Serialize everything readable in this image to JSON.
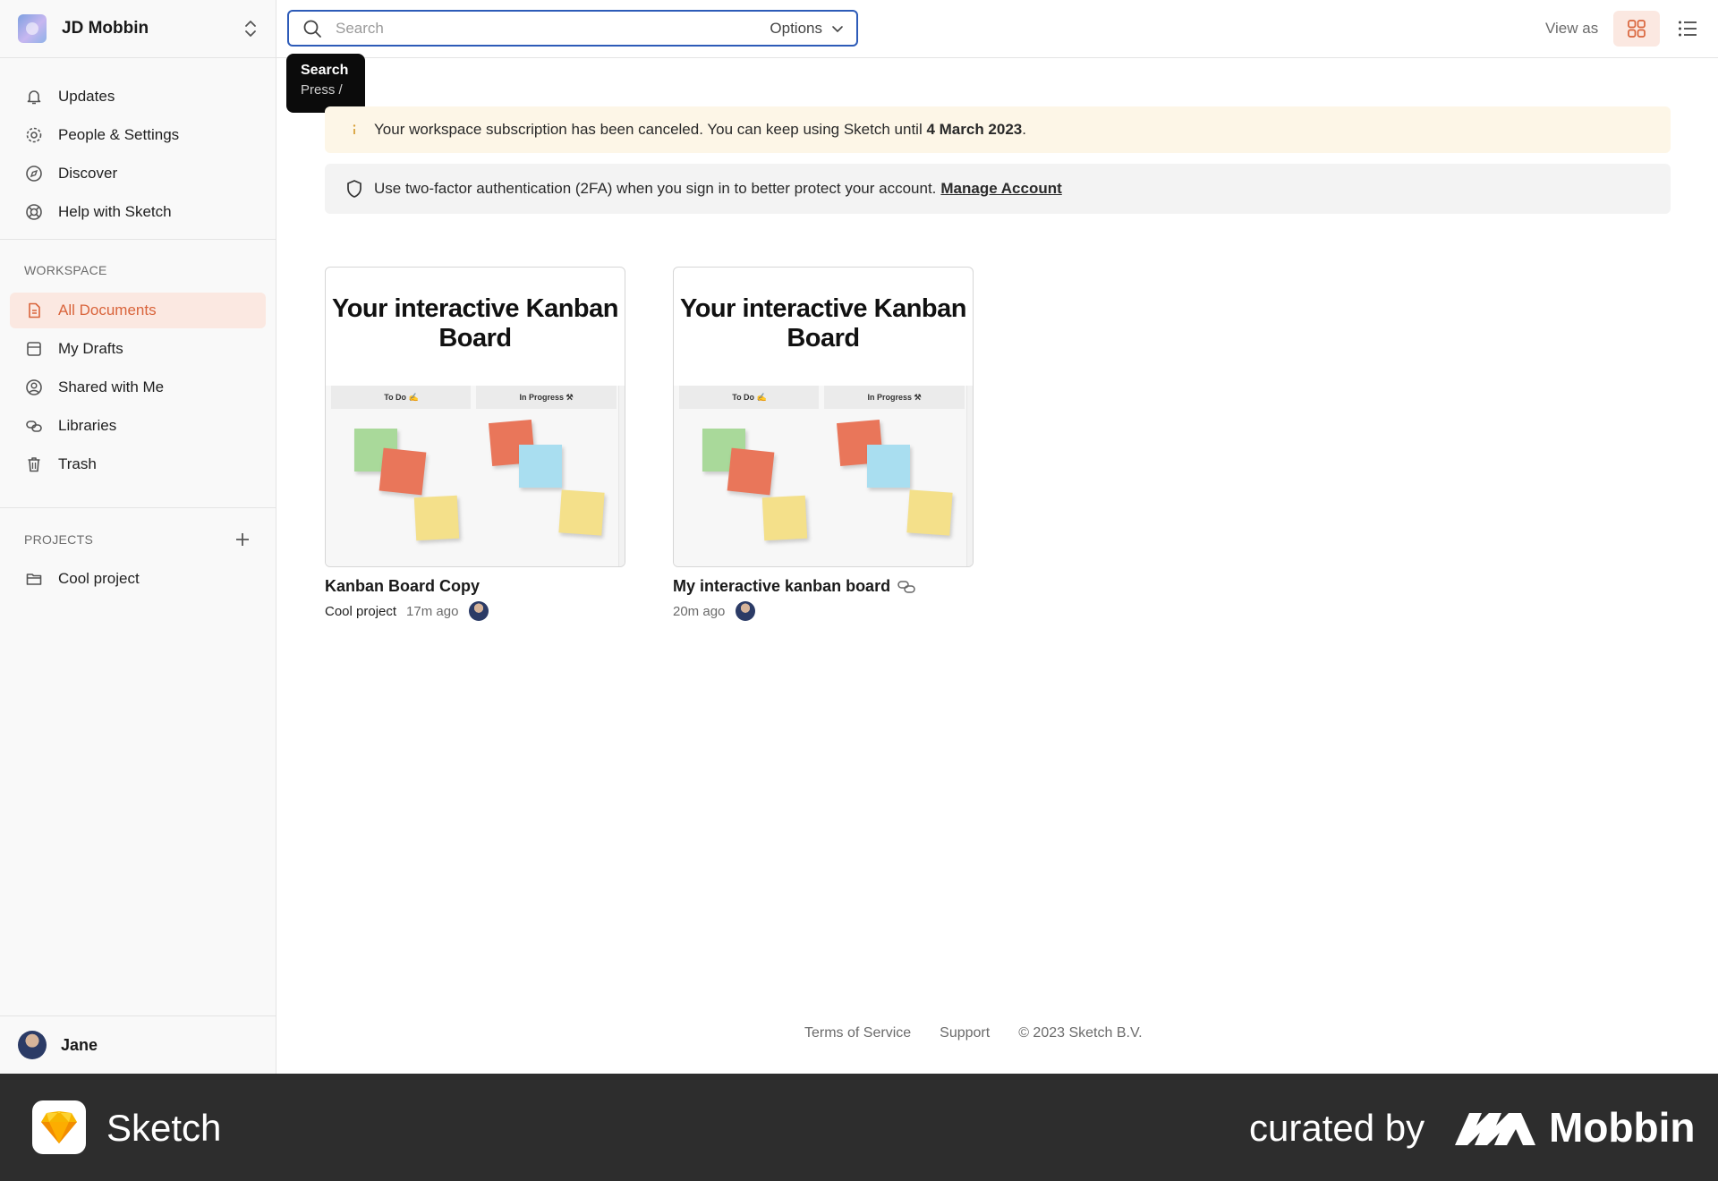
{
  "workspace": {
    "name": "JD Mobbin"
  },
  "search": {
    "placeholder": "Search",
    "options_label": "Options",
    "tooltip_title": "Search",
    "tooltip_hint": "Press /"
  },
  "view": {
    "label": "View as"
  },
  "sidebar": {
    "top_items": [
      {
        "label": "Updates",
        "icon": "bell-icon"
      },
      {
        "label": "People & Settings",
        "icon": "gear-icon"
      },
      {
        "label": "Discover",
        "icon": "compass-icon"
      },
      {
        "label": "Help with Sketch",
        "icon": "lifebuoy-icon"
      }
    ],
    "workspace_label": "WORKSPACE",
    "workspace_items": [
      {
        "label": "All Documents",
        "icon": "document-icon",
        "active": true
      },
      {
        "label": "My Drafts",
        "icon": "drafts-icon"
      },
      {
        "label": "Shared with Me",
        "icon": "user-circle-icon"
      },
      {
        "label": "Libraries",
        "icon": "link-icon"
      },
      {
        "label": "Trash",
        "icon": "trash-icon"
      }
    ],
    "projects_label": "PROJECTS",
    "projects": [
      {
        "label": "Cool project",
        "icon": "folder-icon"
      }
    ],
    "user": {
      "name": "Jane"
    }
  },
  "banners": {
    "subscription": {
      "text": "Your workspace subscription has been canceled. You can keep using Sketch until ",
      "date": "4 March 2023",
      "suffix": "."
    },
    "twofa": {
      "text": "Use two-factor authentication (2FA) when you sign in to better protect your account.",
      "link": "Manage Account"
    }
  },
  "documents": [
    {
      "thumb_title": "Your interactive Kanban Board",
      "col1": "To Do ✍",
      "col2": "In Progress ⚒",
      "title": "Kanban Board Copy",
      "project": "Cool project",
      "time": "17m ago"
    },
    {
      "thumb_title": "Your interactive Kanban Board",
      "col1": "To Do ✍",
      "col2": "In Progress ⚒",
      "title": "My interactive kanban board",
      "project": "",
      "time": "20m ago"
    }
  ],
  "footer": {
    "terms": "Terms of Service",
    "support": "Support",
    "copyright": "© 2023 Sketch B.V."
  },
  "brand": {
    "app": "Sketch",
    "curated": "curated by",
    "mobbin": "Mobbin"
  },
  "colors": {
    "accent": "#d9643b",
    "active_bg": "#fbe8e1",
    "focus_border": "#2d5bb8",
    "warn_bg": "#fdf6e7"
  }
}
